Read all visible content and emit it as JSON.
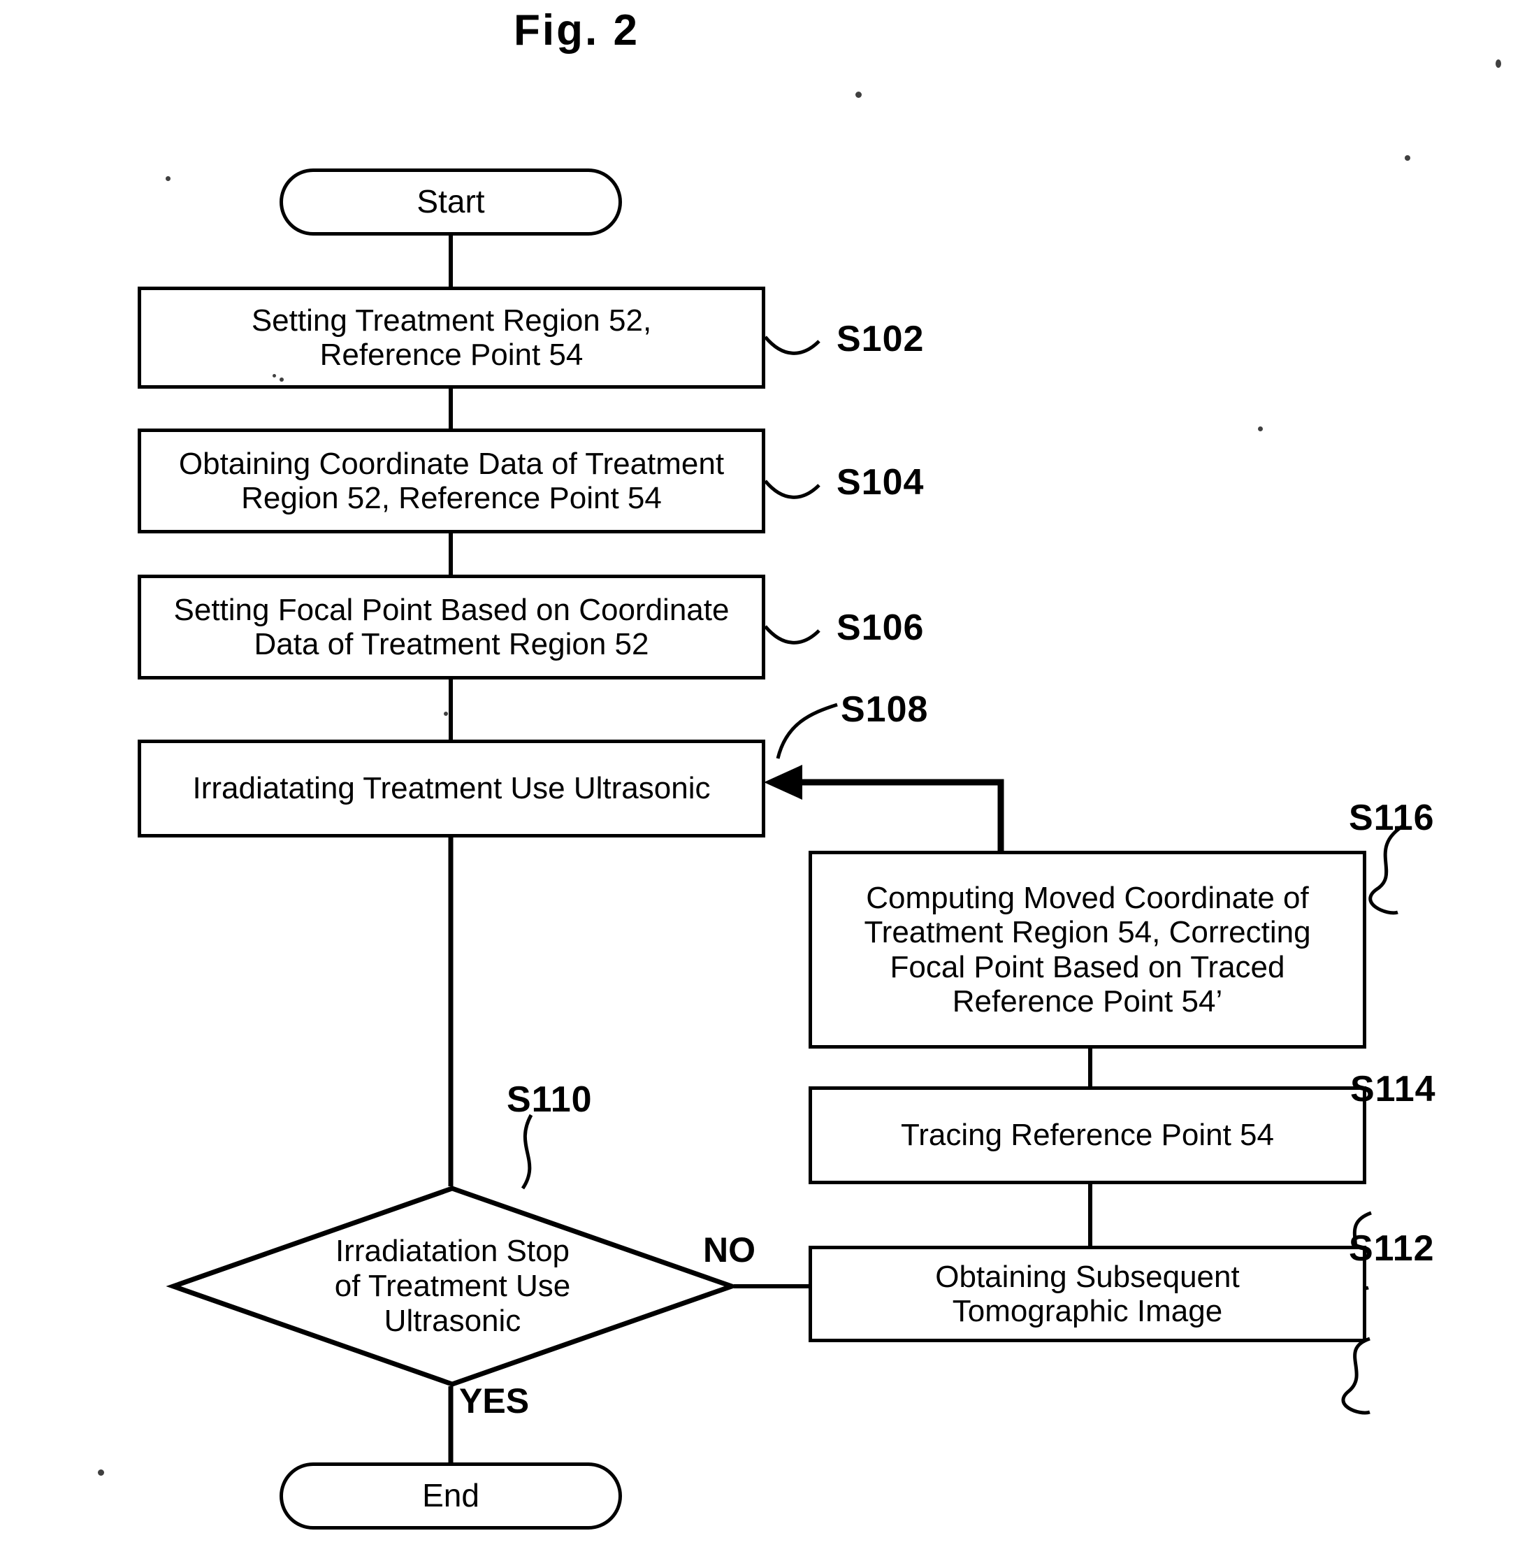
{
  "figure": {
    "title": "Fig. 2"
  },
  "diagram": {
    "type": "flowchart",
    "nodes": [
      {
        "id": "start",
        "shape": "terminal",
        "label": "Start"
      },
      {
        "id": "s102",
        "shape": "process",
        "label": "Setting Treatment Region 52,\nReference Point 54",
        "step": "S102"
      },
      {
        "id": "s104",
        "shape": "process",
        "label": "Obtaining Coordinate Data of Treatment\nRegion 52, Reference Point 54",
        "step": "S104"
      },
      {
        "id": "s106",
        "shape": "process",
        "label": "Setting Focal Point Based on Coordinate\nData of Treatment Region 52",
        "step": "S106"
      },
      {
        "id": "s108",
        "shape": "process",
        "label": "Irradiatating Treatment Use Ultrasonic",
        "step": "S108"
      },
      {
        "id": "s110",
        "shape": "decision",
        "label": "Irradiatation Stop\nof Treatment Use\nUltrasonic",
        "step": "S110"
      },
      {
        "id": "s112",
        "shape": "process",
        "label": "Obtaining Subsequent\nTomographic  Image",
        "step": "S112"
      },
      {
        "id": "s114",
        "shape": "process",
        "label": "Tracing Reference Point  54",
        "step": "S114"
      },
      {
        "id": "s116",
        "shape": "process",
        "label": "Computing Moved Coordinate of\nTreatment Region 54, Correcting\nFocal Point Based on Traced\nReference Point 54’",
        "step": "S116"
      },
      {
        "id": "end",
        "shape": "terminal",
        "label": "End"
      }
    ],
    "step_labels": {
      "s102": "S102",
      "s104": "S104",
      "s106": "S106",
      "s108": "S108",
      "s110": "S110",
      "s112": "S112",
      "s114": "S114",
      "s116": "S116"
    },
    "node_labels": {
      "start": "Start",
      "s102_line1": "Setting Treatment Region 52,",
      "s102_line2": "Reference Point 54",
      "s104_line1": "Obtaining Coordinate Data of Treatment",
      "s104_line2": "Region 52, Reference Point 54",
      "s106_line1": "Setting Focal Point Based on Coordinate",
      "s106_line2": "Data of Treatment Region 52",
      "s108": "Irradiatating Treatment Use Ultrasonic",
      "s110_line1": "Irradiatation Stop",
      "s110_line2": "of Treatment Use",
      "s110_line3": "Ultrasonic",
      "s112_line1": "Obtaining Subsequent",
      "s112_line2": "Tomographic  Image",
      "s114": "Tracing Reference Point  54",
      "s116_line1": "Computing Moved Coordinate of",
      "s116_line2": "Treatment Region 54, Correcting",
      "s116_line3": "Focal Point Based on Traced",
      "s116_line4": "Reference Point 54’",
      "end": "End"
    },
    "branch_labels": {
      "no": "NO",
      "yes": "YES"
    },
    "edges": [
      {
        "from": "start",
        "to": "s102",
        "label": ""
      },
      {
        "from": "s102",
        "to": "s104",
        "label": ""
      },
      {
        "from": "s104",
        "to": "s106",
        "label": ""
      },
      {
        "from": "s106",
        "to": "s108",
        "label": ""
      },
      {
        "from": "s108",
        "to": "s110",
        "label": ""
      },
      {
        "from": "s110",
        "to": "s112",
        "label": "NO"
      },
      {
        "from": "s112",
        "to": "s114",
        "label": ""
      },
      {
        "from": "s114",
        "to": "s116",
        "label": ""
      },
      {
        "from": "s116",
        "to": "s108",
        "label": ""
      },
      {
        "from": "s110",
        "to": "end",
        "label": "YES"
      }
    ],
    "colors": {
      "stroke": "#000000",
      "fill": "#ffffff",
      "text": "#000000"
    }
  }
}
